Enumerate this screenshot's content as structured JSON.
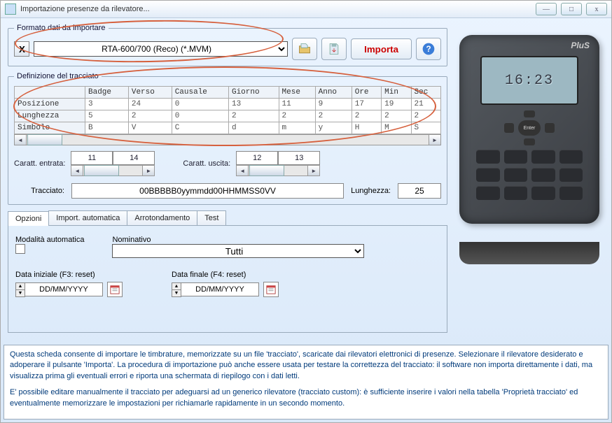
{
  "window": {
    "title": "Importazione presenze da rilevatore..."
  },
  "winbtns": {
    "min": "—",
    "max": "□",
    "close": "x"
  },
  "format": {
    "legend": "Formato dati da importare",
    "x": "X",
    "selected": "RTA-600/700 (Reco)  (*.MVM)",
    "import": "Importa"
  },
  "tracciato": {
    "legend": "Definizione del tracciato",
    "cols": [
      "",
      "Badge",
      "Verso",
      "Causale",
      "Giorno",
      "Mese",
      "Anno",
      "Ore",
      "Min",
      "Sec"
    ],
    "rows": [
      {
        "h": "Posizione",
        "c": [
          "3",
          "24",
          "0",
          "13",
          "11",
          "9",
          "17",
          "19",
          "21"
        ]
      },
      {
        "h": "Lunghezza",
        "c": [
          "5",
          "2",
          "0",
          "2",
          "2",
          "2",
          "2",
          "2",
          "2"
        ]
      },
      {
        "h": "Simbolo",
        "c": [
          "B",
          "V",
          "C",
          "d",
          "m",
          "y",
          "H",
          "M",
          "S"
        ]
      }
    ],
    "caratt_in_lbl": "Caratt. entrata:",
    "caratt_in": [
      "11",
      "14"
    ],
    "caratt_out_lbl": "Caratt. uscita:",
    "caratt_out": [
      "12",
      "13"
    ],
    "trac_lbl": "Tracciato:",
    "trac_val": "00BBBBB0yymmdd00HHMMSS0VV",
    "len_lbl": "Lunghezza:",
    "len_val": "25"
  },
  "tabs": {
    "t1": "Opzioni",
    "t2": "Import. automatica",
    "t3": "Arrotondamento",
    "t4": "Test"
  },
  "opzioni": {
    "auto_lbl": "Modalità automatica",
    "nom_lbl": "Nominativo",
    "nom_val": "Tutti",
    "d1_lbl": "Data iniziale (F3: reset)",
    "d1_val": "DD/MM/YYYY",
    "d2_lbl": "Data finale (F4: reset)",
    "d2_val": "DD/MM/YYYY"
  },
  "device": {
    "brand": "PluS",
    "time": "16:23",
    "enter": "Enter"
  },
  "footer": {
    "p1": "Questa scheda consente di importare le timbrature, memorizzate su un file 'tracciato', scaricate dai rilevatori elettronici di presenze. Selezionare il rilevatore desiderato e adoperare il pulsante 'Importa'.  La procedura di importazione può anche essere usata per testare la correttezza del tracciato: il software non importa direttamente i dati, ma visualizza prima gli eventuali errori e riporta una schermata di riepilogo con i dati letti.",
    "p2": "E' possibile editare manualmente il tracciato per adeguarsi ad un generico rilevatore (tracciato custom): è sufficiente inserire i valori nella tabella 'Proprietà tracciato' ed eventualmente memorizzare le impostazioni per richiamarle rapidamente in un secondo momento."
  }
}
